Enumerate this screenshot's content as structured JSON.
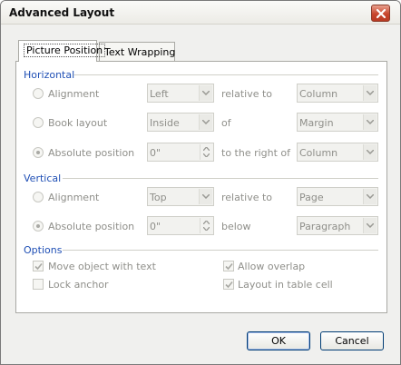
{
  "window": {
    "title": "Advanced Layout"
  },
  "tabs": [
    {
      "label": "Picture Position",
      "active": true
    },
    {
      "label": "Text Wrapping",
      "active": false
    }
  ],
  "horizontal": {
    "heading": "Horizontal",
    "alignment": {
      "label": "Alignment",
      "value": "Left",
      "relation": "relative to",
      "target": "Column",
      "selected": false
    },
    "book_layout": {
      "label": "Book layout",
      "value": "Inside",
      "relation": "of",
      "target": "Margin",
      "selected": false
    },
    "absolute": {
      "label": "Absolute position",
      "value": "0\"",
      "relation": "to the right of",
      "target": "Column",
      "selected": true
    }
  },
  "vertical": {
    "heading": "Vertical",
    "alignment": {
      "label": "Alignment",
      "value": "Top",
      "relation": "relative to",
      "target": "Page",
      "selected": false
    },
    "absolute": {
      "label": "Absolute position",
      "value": "0\"",
      "relation": "below",
      "target": "Paragraph",
      "selected": true
    }
  },
  "options": {
    "heading": "Options",
    "move_with_text": {
      "label": "Move object with text",
      "checked": true
    },
    "lock_anchor": {
      "label": "Lock anchor",
      "checked": false
    },
    "allow_overlap": {
      "label": "Allow overlap",
      "checked": true
    },
    "layout_in_table": {
      "label": "Layout in table cell",
      "checked": true
    }
  },
  "buttons": {
    "ok": "OK",
    "cancel": "Cancel"
  }
}
